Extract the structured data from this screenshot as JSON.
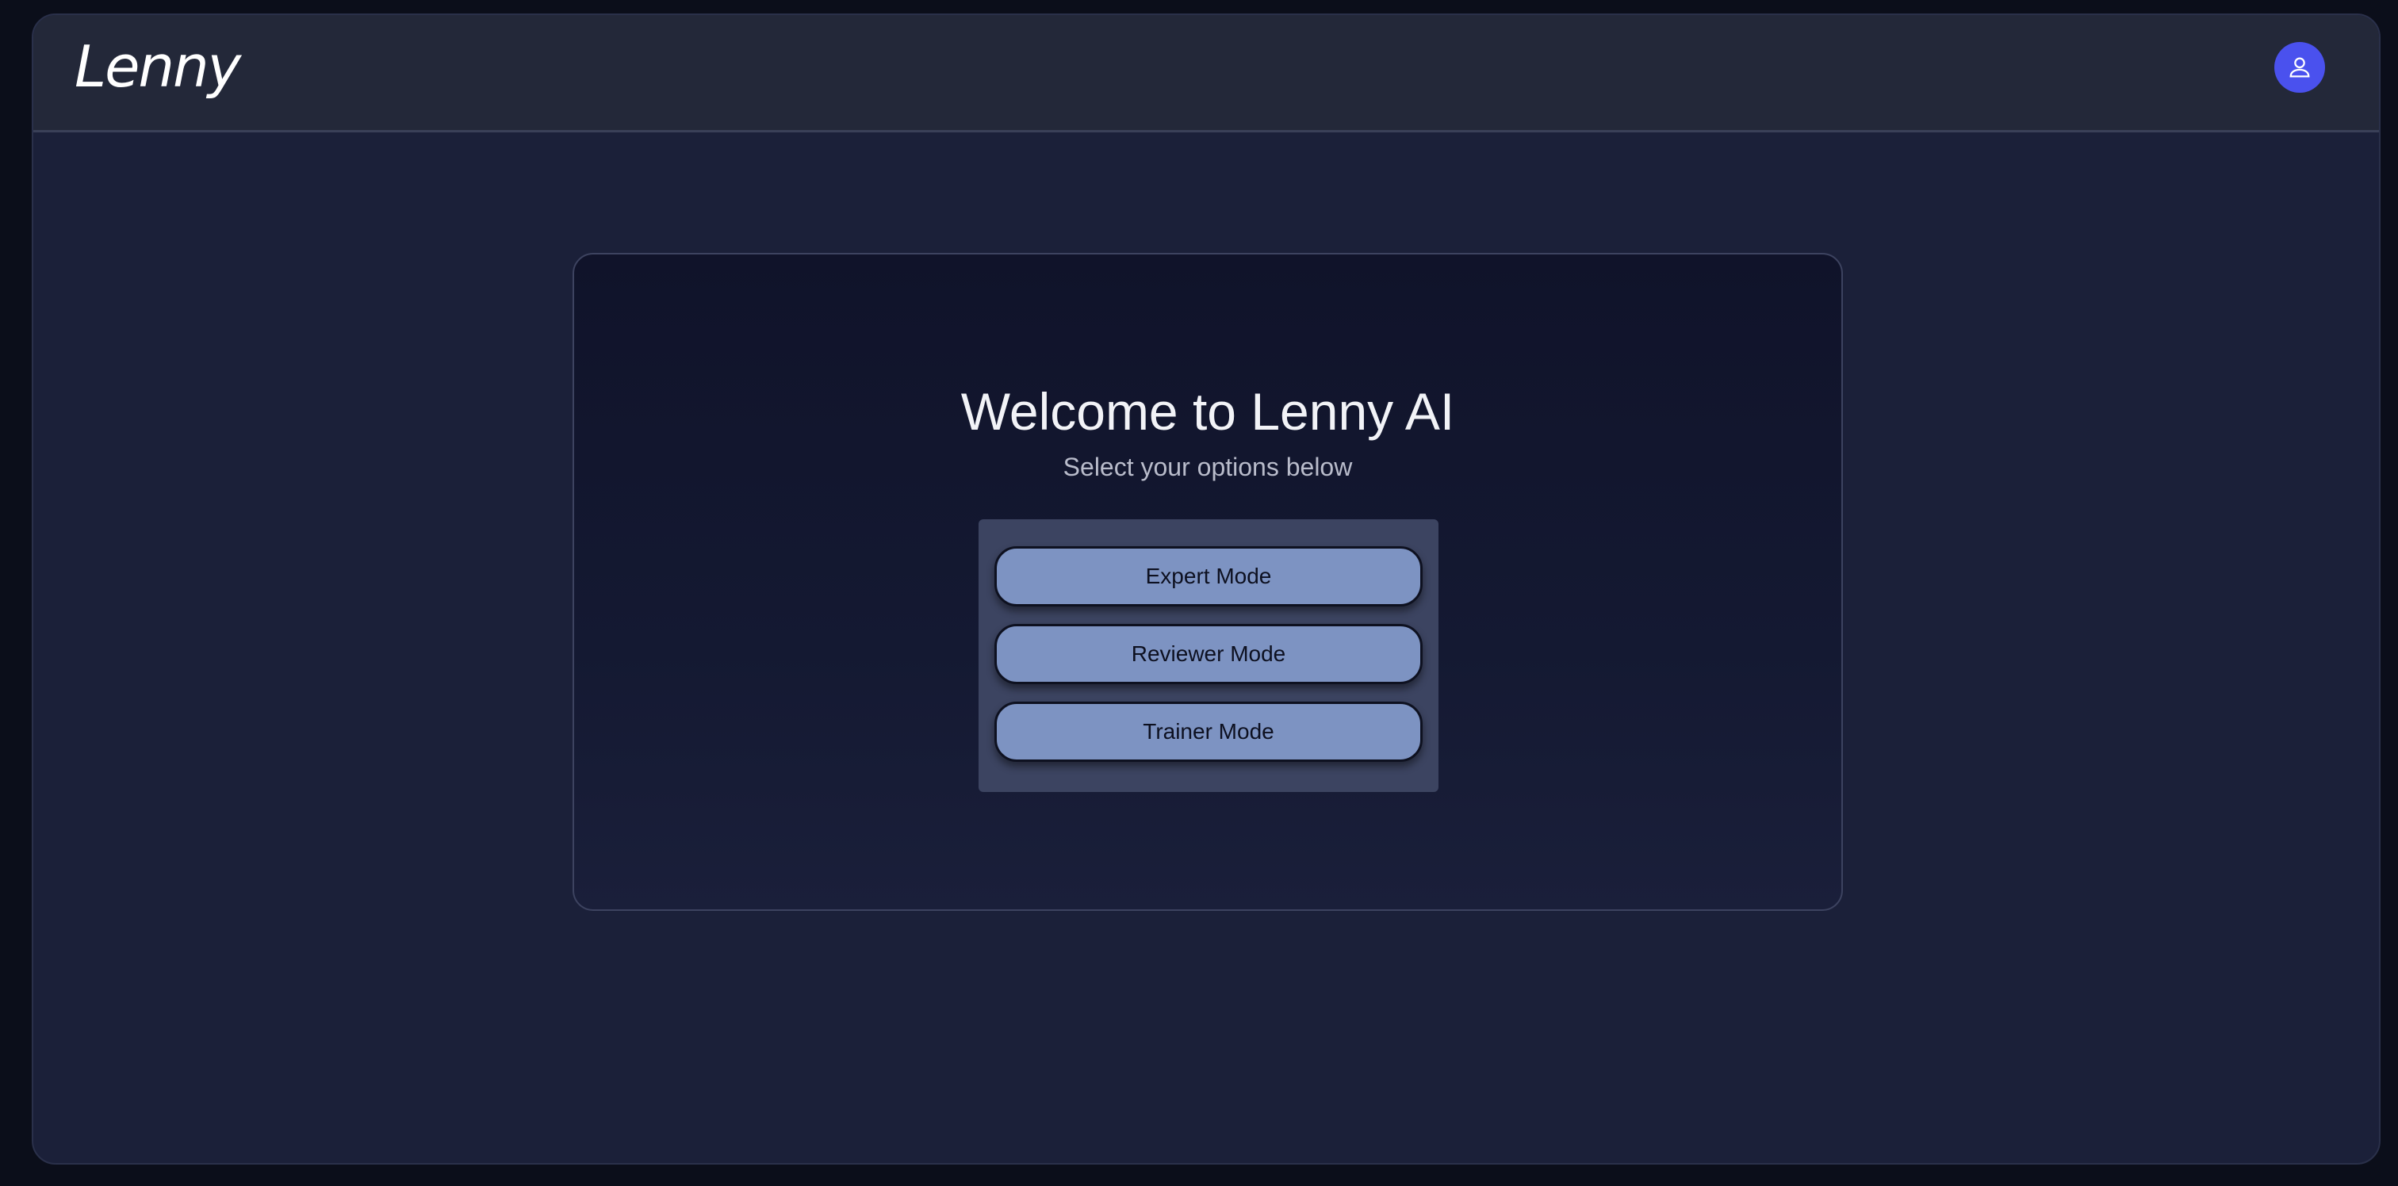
{
  "header": {
    "logo_text": "Lenny"
  },
  "main": {
    "title": "Welcome to Lenny AI",
    "subtitle": "Select your options below",
    "modes": [
      {
        "label": "Expert Mode"
      },
      {
        "label": "Reviewer Mode"
      },
      {
        "label": "Trainer Mode"
      }
    ]
  },
  "icons": {
    "user": "user-icon"
  },
  "colors": {
    "background": "#1b2039",
    "header": "#232839",
    "avatar": "#4a51ee",
    "button": "#7d93c2",
    "panel": "#3c4461"
  }
}
